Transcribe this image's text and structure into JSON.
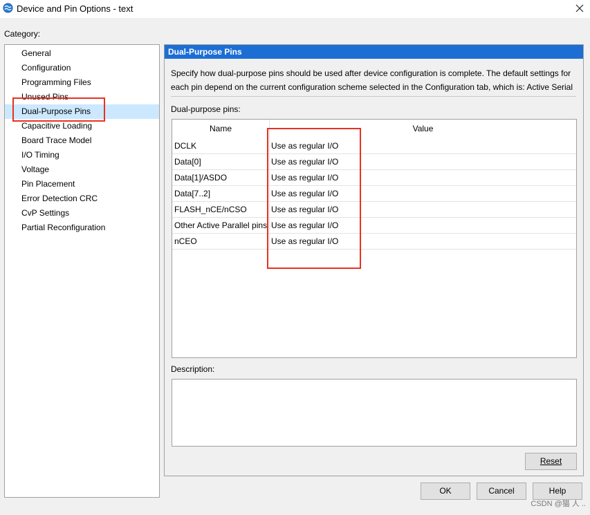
{
  "window": {
    "title": "Device and Pin Options - text",
    "close_glyph": "✕",
    "icon": "app-globe-icon"
  },
  "category": {
    "label": "Category:",
    "items": [
      "General",
      "Configuration",
      "Programming Files",
      "Unused Pins",
      "Dual-Purpose Pins",
      "Capacitive Loading",
      "Board Trace Model",
      "I/O Timing",
      "Voltage",
      "Pin Placement",
      "Error Detection CRC",
      "CvP Settings",
      "Partial Reconfiguration"
    ],
    "selected": "Dual-Purpose Pins"
  },
  "panel": {
    "header": "Dual-Purpose Pins",
    "description_lines": [
      "Specify how dual-purpose pins should be used after device configuration is complete. The default settings for",
      "each pin depend on the current configuration scheme selected in the Configuration tab, which is:  Active Serial"
    ],
    "pins_label": "Dual-purpose pins:",
    "columns": {
      "name": "Name",
      "value": "Value"
    },
    "rows": [
      {
        "name": "DCLK",
        "value": "Use as regular I/O"
      },
      {
        "name": "Data[0]",
        "value": "Use as regular I/O"
      },
      {
        "name": "Data[1]/ASDO",
        "value": "Use as regular I/O"
      },
      {
        "name": "Data[7..2]",
        "value": "Use as regular I/O"
      },
      {
        "name": "FLASH_nCE/nCSO",
        "value": "Use as regular I/O"
      },
      {
        "name": "Other Active Parallel pins",
        "value": "Use as regular I/O"
      },
      {
        "name": "nCEO",
        "value": "Use as regular I/O"
      }
    ],
    "description_label": "Description:",
    "reset_label": "Reset"
  },
  "buttons": {
    "ok": "OK",
    "cancel": "Cancel",
    "help": "Help"
  },
  "watermark": "CSDN @猫 人 ..",
  "colors": {
    "header_blue": "#1c6ed5",
    "selection": "#cce8ff",
    "annotation_red": "#e8301f"
  }
}
